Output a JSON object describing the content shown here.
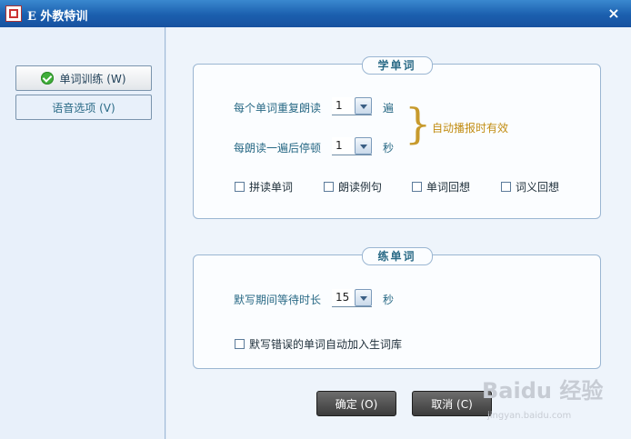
{
  "window": {
    "title": "E 外教特训",
    "close": "×"
  },
  "sidebar": {
    "items": [
      {
        "label": "单词训练 (W)",
        "icon": "check-circle-icon",
        "active": true
      },
      {
        "label": "语音选项 (V)",
        "active": false
      }
    ]
  },
  "learn": {
    "legend": "学单词",
    "repeat_label": "每个单词重复朗读",
    "repeat_value": "1",
    "repeat_unit": "遍",
    "pause_label": "每朗读一遍后停顿",
    "pause_value": "1",
    "pause_unit": "秒",
    "note": "自动播报时有效",
    "checkboxes": [
      {
        "label": "拼读单词",
        "checked": false
      },
      {
        "label": "朗读例句",
        "checked": false
      },
      {
        "label": "单词回想",
        "checked": false
      },
      {
        "label": "词义回想",
        "checked": false
      }
    ]
  },
  "practice": {
    "legend": "练单词",
    "wait_label": "默写期间等待时长",
    "wait_value": "15",
    "wait_unit": "秒",
    "auto_add_label": "默写错误的单词自动加入生词库",
    "auto_add_checked": false
  },
  "buttons": {
    "ok": "确定 (O)",
    "cancel": "取消 (C)"
  },
  "watermark": {
    "main": "Baidu 经验",
    "sub": "jingyan.baidu.com"
  },
  "colors": {
    "title_bar": "#1f63b0",
    "note": "#c28d13",
    "label": "#2a6a86"
  }
}
